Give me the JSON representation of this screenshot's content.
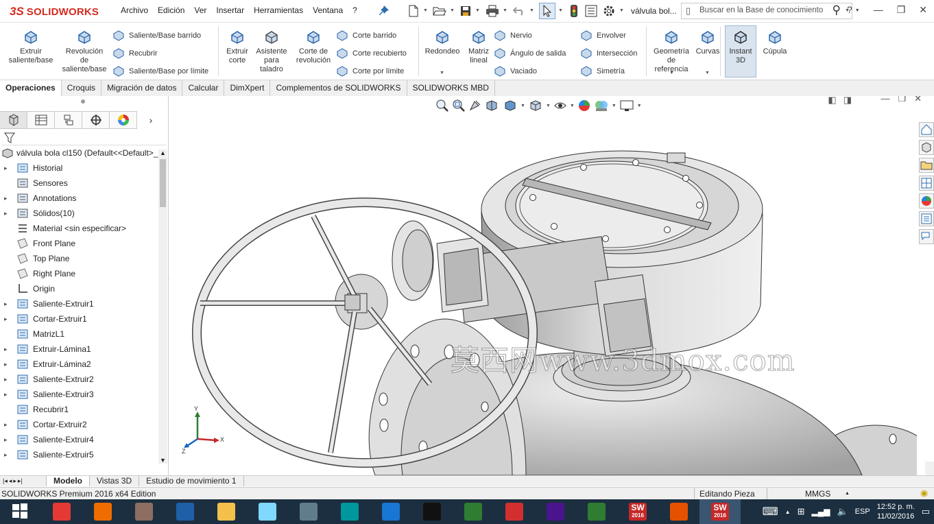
{
  "app": {
    "logo_ds": "3S",
    "logo_name": "SOLIDWORKS",
    "document_title": "válvula bol...",
    "colors": {
      "brand": "#d42b1e",
      "taskbar": "#1c2f40",
      "accent": "#d9e4ef"
    }
  },
  "menu": [
    "Archivo",
    "Edición",
    "Ver",
    "Insertar",
    "Herramientas",
    "Ventana",
    "?"
  ],
  "search": {
    "placeholder": "Buscar en la Base de conocimiento"
  },
  "toolbar_icons": [
    "pin-icon",
    "new-icon",
    "open-icon",
    "save-icon",
    "print-icon",
    "undo-icon",
    "select-icon",
    "rebuild-icon",
    "file-properties-icon",
    "options-icon"
  ],
  "command_manager": {
    "big": [
      {
        "id": "extruir-saliente",
        "label": "Extruir\nsaliente/base"
      },
      {
        "id": "revolucion-saliente",
        "label": "Revolución\nde\nsaliente/base"
      },
      {
        "id": "extruir-corte",
        "label": "Extruir\ncorte"
      },
      {
        "id": "asistente-taladro",
        "label": "Asistente\npara\ntaladro"
      },
      {
        "id": "corte-revolucion",
        "label": "Corte de\nrevolución"
      },
      {
        "id": "redondeo",
        "label": "Redondeo"
      },
      {
        "id": "matriz-lineal",
        "label": "Matriz\nlineal"
      },
      {
        "id": "geometria-referencia",
        "label": "Geometría\nde\nreferencia"
      },
      {
        "id": "curvas",
        "label": "Curvas"
      },
      {
        "id": "instant-3d",
        "label": "Instant\n3D"
      },
      {
        "id": "cupula",
        "label": "Cúpula"
      }
    ],
    "small": [
      {
        "id": "saliente-barrido",
        "label": "Saliente/Base barrido"
      },
      {
        "id": "recubrir",
        "label": "Recubrir"
      },
      {
        "id": "saliente-limite",
        "label": "Saliente/Base por límite"
      },
      {
        "id": "corte-barrido",
        "label": "Corte barrido"
      },
      {
        "id": "corte-recubierto",
        "label": "Corte recubierto"
      },
      {
        "id": "corte-limite",
        "label": "Corte por límite"
      },
      {
        "id": "nervio",
        "label": "Nervio"
      },
      {
        "id": "angulo-salida",
        "label": "Ángulo de salida"
      },
      {
        "id": "vaciado",
        "label": "Vaciado"
      },
      {
        "id": "envolver",
        "label": "Envolver"
      },
      {
        "id": "interseccion",
        "label": "Intersección"
      },
      {
        "id": "simetria",
        "label": "Simetría"
      }
    ]
  },
  "command_tabs": [
    "Operaciones",
    "Croquis",
    "Migración de datos",
    "Calcular",
    "DimXpert",
    "Complementos de SOLIDWORKS",
    "SOLIDWORKS MBD"
  ],
  "tree": {
    "root": "válvula bola cl150  (Default<<Default>_",
    "items": [
      {
        "label": "Historial",
        "icon": "history-icon",
        "expandable": true
      },
      {
        "label": "Sensores",
        "icon": "sensor-icon",
        "expandable": false
      },
      {
        "label": "Annotations",
        "icon": "annotations-icon",
        "expandable": true
      },
      {
        "label": "Sólidos(10)",
        "icon": "solid-bodies-icon",
        "expandable": true
      },
      {
        "label": "Material <sin especificar>",
        "icon": "material-icon",
        "expandable": false
      },
      {
        "label": "Front Plane",
        "icon": "plane-icon",
        "expandable": false
      },
      {
        "label": "Top Plane",
        "icon": "plane-icon",
        "expandable": false
      },
      {
        "label": "Right Plane",
        "icon": "plane-icon",
        "expandable": false
      },
      {
        "label": "Origin",
        "icon": "origin-icon",
        "expandable": false
      },
      {
        "label": "Saliente-Extruir1",
        "icon": "extrude-icon",
        "expandable": true
      },
      {
        "label": "Cortar-Extruir1",
        "icon": "cut-icon",
        "expandable": true
      },
      {
        "label": "MatrizL1",
        "icon": "pattern-icon",
        "expandable": false
      },
      {
        "label": "Extruir-Lámina1",
        "icon": "extrude-icon",
        "expandable": true
      },
      {
        "label": "Extruir-Lámina2",
        "icon": "extrude-icon",
        "expandable": true
      },
      {
        "label": "Saliente-Extruir2",
        "icon": "extrude-icon",
        "expandable": true
      },
      {
        "label": "Saliente-Extruir3",
        "icon": "extrude-icon",
        "expandable": true
      },
      {
        "label": "Recubrir1",
        "icon": "loft-icon",
        "expandable": false
      },
      {
        "label": "Cortar-Extruir2",
        "icon": "cut-icon",
        "expandable": true
      },
      {
        "label": "Saliente-Extruir4",
        "icon": "extrude-icon",
        "expandable": true
      },
      {
        "label": "Saliente-Extruir5",
        "icon": "extrude-icon",
        "expandable": true
      }
    ]
  },
  "bottom_tabs": [
    "Modelo",
    "Vistas 3D",
    "Estudio de movimiento 1"
  ],
  "status": {
    "left": "SOLIDWORKS Premium 2016 x64 Edition",
    "mode": "Editando Pieza",
    "units": "MMGS"
  },
  "watermark": "莫西网www.3dmox.com",
  "triad": {
    "x": "X",
    "y": "Y",
    "z": "Z"
  },
  "taskbar": {
    "apps": [
      "start-icon",
      "chrome-icon",
      "paint-icon",
      "paint-palette-icon",
      "word-icon",
      "file-explorer-icon",
      "notepad-icon",
      "molecule-icon",
      "arduino-icon",
      "sigma-icon",
      "terminal-icon",
      "c-app-icon",
      "f-app-icon",
      "box-icon",
      "pcb-icon",
      "solidworks-2016-icon",
      "matlab-icon",
      "solidworks-2016-active-icon"
    ],
    "sw_label": "SW",
    "sw_year": "2016",
    "lang": "ESP",
    "time": "12:52 p. m.",
    "date": "11/02/2016"
  }
}
